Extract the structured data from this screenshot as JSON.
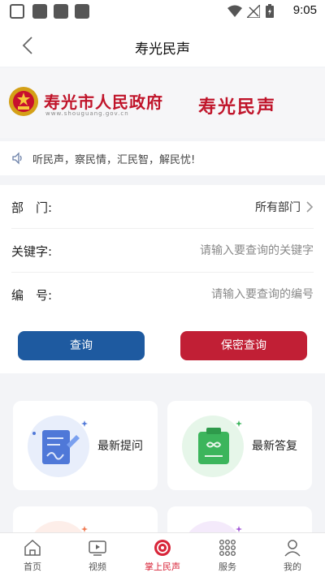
{
  "status_bar": {
    "time": "9:05",
    "icons": [
      "message-icon",
      "app-icon",
      "app-icon",
      "app-icon",
      "wifi-icon",
      "no-signal-icon",
      "battery-charging-icon"
    ]
  },
  "nav": {
    "title": "寿光民声",
    "back_icon": "back-arrow-icon"
  },
  "banner": {
    "gov_name": "寿光市人民政府",
    "gov_url": "www.shouguang.gov.cn",
    "brand": "寿光民声",
    "brand_color": "#c0142a"
  },
  "notice": {
    "icon": "speaker-icon",
    "text": "听民声，察民情，汇民智，解民忧!"
  },
  "form": {
    "department": {
      "label": "部　门:",
      "value": "所有部门"
    },
    "keyword": {
      "label": "关键字:",
      "placeholder": "请输入要查询的关键字"
    },
    "number": {
      "label": "编　号:",
      "placeholder": "请输入要查询的编号"
    },
    "query_button": "查询",
    "secret_query_button": "保密查询",
    "query_color": "#1e5aa0",
    "secret_color": "#c11f35"
  },
  "cards": [
    {
      "label": "最新提问",
      "icon": "document-edit-icon"
    },
    {
      "label": "最新答复",
      "icon": "clipboard-reply-icon"
    },
    {
      "label": "",
      "icon": "orange-icon"
    },
    {
      "label": "",
      "icon": "purple-icon"
    }
  ],
  "tabbar": {
    "active_color": "#d8263a",
    "items": [
      {
        "label": "首页",
        "icon": "home-icon"
      },
      {
        "label": "视频",
        "icon": "video-icon"
      },
      {
        "label": "掌上民声",
        "icon": "palm-voice-icon"
      },
      {
        "label": "服务",
        "icon": "grid-icon"
      },
      {
        "label": "我的",
        "icon": "user-icon"
      }
    ]
  }
}
